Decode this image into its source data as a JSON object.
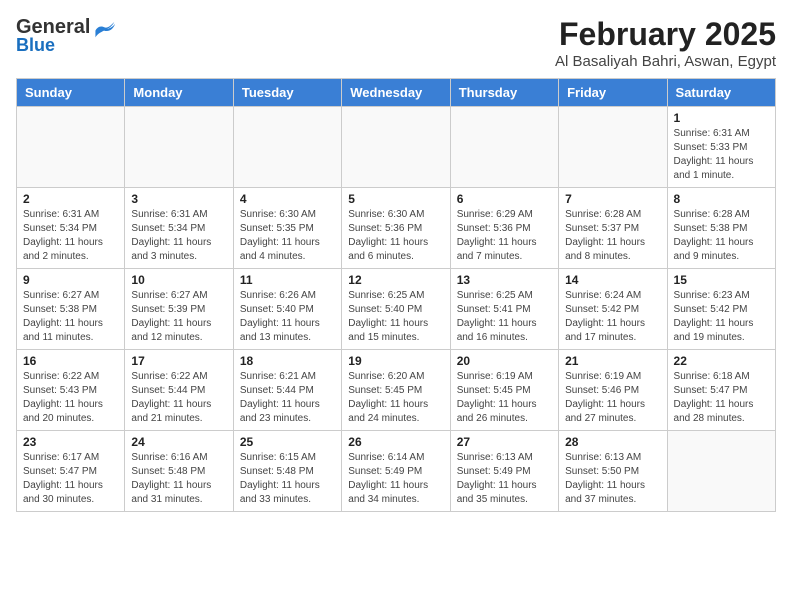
{
  "logo": {
    "general": "General",
    "blue": "Blue"
  },
  "header": {
    "title": "February 2025",
    "subtitle": "Al Basaliyah Bahri, Aswan, Egypt"
  },
  "weekdays": [
    "Sunday",
    "Monday",
    "Tuesday",
    "Wednesday",
    "Thursday",
    "Friday",
    "Saturday"
  ],
  "weeks": [
    [
      {
        "day": "",
        "info": ""
      },
      {
        "day": "",
        "info": ""
      },
      {
        "day": "",
        "info": ""
      },
      {
        "day": "",
        "info": ""
      },
      {
        "day": "",
        "info": ""
      },
      {
        "day": "",
        "info": ""
      },
      {
        "day": "1",
        "info": "Sunrise: 6:31 AM\nSunset: 5:33 PM\nDaylight: 11 hours and 1 minute."
      }
    ],
    [
      {
        "day": "2",
        "info": "Sunrise: 6:31 AM\nSunset: 5:34 PM\nDaylight: 11 hours and 2 minutes."
      },
      {
        "day": "3",
        "info": "Sunrise: 6:31 AM\nSunset: 5:34 PM\nDaylight: 11 hours and 3 minutes."
      },
      {
        "day": "4",
        "info": "Sunrise: 6:30 AM\nSunset: 5:35 PM\nDaylight: 11 hours and 4 minutes."
      },
      {
        "day": "5",
        "info": "Sunrise: 6:30 AM\nSunset: 5:36 PM\nDaylight: 11 hours and 6 minutes."
      },
      {
        "day": "6",
        "info": "Sunrise: 6:29 AM\nSunset: 5:36 PM\nDaylight: 11 hours and 7 minutes."
      },
      {
        "day": "7",
        "info": "Sunrise: 6:28 AM\nSunset: 5:37 PM\nDaylight: 11 hours and 8 minutes."
      },
      {
        "day": "8",
        "info": "Sunrise: 6:28 AM\nSunset: 5:38 PM\nDaylight: 11 hours and 9 minutes."
      }
    ],
    [
      {
        "day": "9",
        "info": "Sunrise: 6:27 AM\nSunset: 5:38 PM\nDaylight: 11 hours and 11 minutes."
      },
      {
        "day": "10",
        "info": "Sunrise: 6:27 AM\nSunset: 5:39 PM\nDaylight: 11 hours and 12 minutes."
      },
      {
        "day": "11",
        "info": "Sunrise: 6:26 AM\nSunset: 5:40 PM\nDaylight: 11 hours and 13 minutes."
      },
      {
        "day": "12",
        "info": "Sunrise: 6:25 AM\nSunset: 5:40 PM\nDaylight: 11 hours and 15 minutes."
      },
      {
        "day": "13",
        "info": "Sunrise: 6:25 AM\nSunset: 5:41 PM\nDaylight: 11 hours and 16 minutes."
      },
      {
        "day": "14",
        "info": "Sunrise: 6:24 AM\nSunset: 5:42 PM\nDaylight: 11 hours and 17 minutes."
      },
      {
        "day": "15",
        "info": "Sunrise: 6:23 AM\nSunset: 5:42 PM\nDaylight: 11 hours and 19 minutes."
      }
    ],
    [
      {
        "day": "16",
        "info": "Sunrise: 6:22 AM\nSunset: 5:43 PM\nDaylight: 11 hours and 20 minutes."
      },
      {
        "day": "17",
        "info": "Sunrise: 6:22 AM\nSunset: 5:44 PM\nDaylight: 11 hours and 21 minutes."
      },
      {
        "day": "18",
        "info": "Sunrise: 6:21 AM\nSunset: 5:44 PM\nDaylight: 11 hours and 23 minutes."
      },
      {
        "day": "19",
        "info": "Sunrise: 6:20 AM\nSunset: 5:45 PM\nDaylight: 11 hours and 24 minutes."
      },
      {
        "day": "20",
        "info": "Sunrise: 6:19 AM\nSunset: 5:45 PM\nDaylight: 11 hours and 26 minutes."
      },
      {
        "day": "21",
        "info": "Sunrise: 6:19 AM\nSunset: 5:46 PM\nDaylight: 11 hours and 27 minutes."
      },
      {
        "day": "22",
        "info": "Sunrise: 6:18 AM\nSunset: 5:47 PM\nDaylight: 11 hours and 28 minutes."
      }
    ],
    [
      {
        "day": "23",
        "info": "Sunrise: 6:17 AM\nSunset: 5:47 PM\nDaylight: 11 hours and 30 minutes."
      },
      {
        "day": "24",
        "info": "Sunrise: 6:16 AM\nSunset: 5:48 PM\nDaylight: 11 hours and 31 minutes."
      },
      {
        "day": "25",
        "info": "Sunrise: 6:15 AM\nSunset: 5:48 PM\nDaylight: 11 hours and 33 minutes."
      },
      {
        "day": "26",
        "info": "Sunrise: 6:14 AM\nSunset: 5:49 PM\nDaylight: 11 hours and 34 minutes."
      },
      {
        "day": "27",
        "info": "Sunrise: 6:13 AM\nSunset: 5:49 PM\nDaylight: 11 hours and 35 minutes."
      },
      {
        "day": "28",
        "info": "Sunrise: 6:13 AM\nSunset: 5:50 PM\nDaylight: 11 hours and 37 minutes."
      },
      {
        "day": "",
        "info": ""
      }
    ]
  ]
}
